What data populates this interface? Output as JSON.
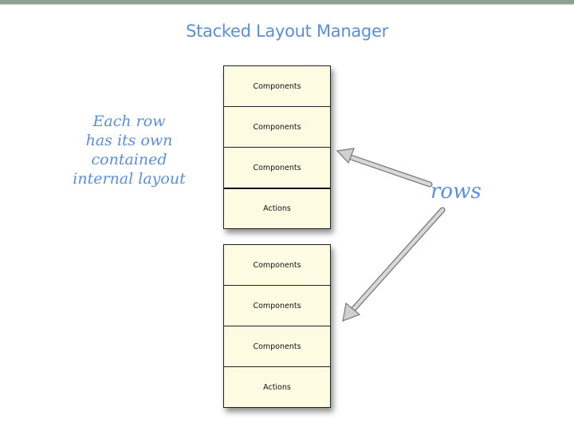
{
  "title": "Stacked Layout Manager",
  "note_lines": [
    "Each row",
    "has its own",
    "contained",
    "internal layout"
  ],
  "rows_label": "rows",
  "stacks": [
    {
      "rows": [
        "Components",
        "Components",
        "Components",
        "Actions"
      ]
    },
    {
      "rows": [
        "Components",
        "Components",
        "Components",
        "Actions"
      ]
    }
  ],
  "colors": {
    "accent_text": "#5b8fdb",
    "row_fill": "#fdfce3",
    "arrow": "#c8c8c8"
  }
}
